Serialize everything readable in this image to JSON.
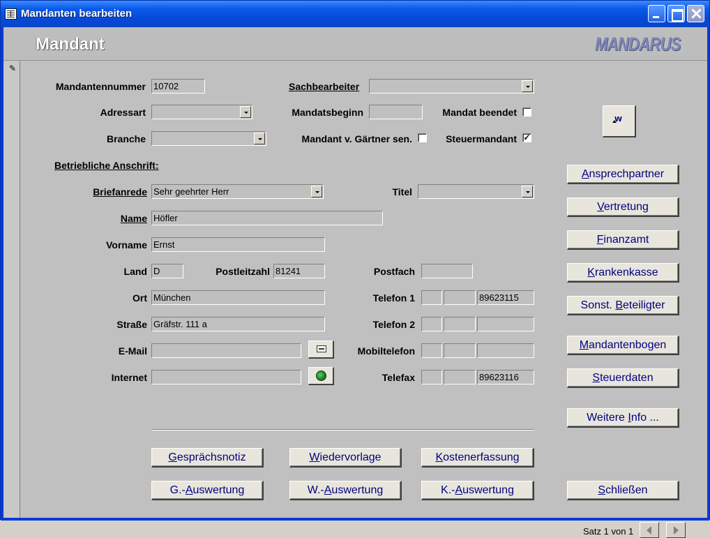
{
  "window": {
    "title": "Mandanten bearbeiten"
  },
  "header": {
    "title": "Mandant",
    "brand": "MANDARUS"
  },
  "record_selector": {
    "icon": "pencil-icon",
    "glyph": "✎"
  },
  "fields": {
    "mandantennummer": {
      "label": "Mandantennummer",
      "value": "10702"
    },
    "sachbearbeiter": {
      "label": "Sachbearbeiter",
      "value": ""
    },
    "adressart": {
      "label": "Adressart",
      "value": ""
    },
    "mandatsbeginn": {
      "label": "Mandatsbeginn",
      "value": ""
    },
    "mandat_beendet": {
      "label": "Mandat beendet",
      "checked": false
    },
    "branche": {
      "label": "Branche",
      "value": ""
    },
    "mandant_gaertner": {
      "label": "Mandant v. Gärtner sen.",
      "checked": false
    },
    "steuermandant": {
      "label": "Steuermandant",
      "checked": true,
      "mark": "✓"
    },
    "section_heading": "Betriebliche Anschrift:",
    "briefanrede": {
      "label": "Briefanrede",
      "value": "Sehr geehrter Herr"
    },
    "titel": {
      "label": "Titel",
      "value": ""
    },
    "name": {
      "label": "Name",
      "value": "Höfler"
    },
    "vorname": {
      "label": "Vorname",
      "value": "Ernst"
    },
    "land": {
      "label": "Land",
      "value": "D"
    },
    "postleitzahl": {
      "label": "Postleitzahl",
      "value": "81241"
    },
    "postfach": {
      "label": "Postfach",
      "value": ""
    },
    "ort": {
      "label": "Ort",
      "value": "München"
    },
    "strasse": {
      "label": "Straße",
      "value": "Gräfstr. 111 a"
    },
    "email": {
      "label": "E-Mail",
      "value": ""
    },
    "internet": {
      "label": "Internet",
      "value": ""
    },
    "telefon1": {
      "label": "Telefon 1",
      "country": "",
      "area": "",
      "number": "89623115"
    },
    "telefon2": {
      "label": "Telefon 2",
      "country": "",
      "area": "",
      "number": ""
    },
    "mobiltelefon": {
      "label": "Mobiltelefon",
      "country": "",
      "area": "",
      "number": ""
    },
    "telefax": {
      "label": "Telefax",
      "country": "",
      "area": "",
      "number": "89623116"
    }
  },
  "side_buttons": [
    {
      "pre": "",
      "ul": "A",
      "post": "nsprechpartner"
    },
    {
      "pre": "",
      "ul": "V",
      "post": "ertretung"
    },
    {
      "pre": "",
      "ul": "F",
      "post": "inanzamt"
    },
    {
      "pre": "",
      "ul": "K",
      "post": "rankenkasse"
    },
    {
      "pre": "Sonst. ",
      "ul": "B",
      "post": "eteiligter"
    },
    {
      "pre": "",
      "ul": "M",
      "post": "andantenbogen"
    },
    {
      "pre": "",
      "ul": "S",
      "post": "teuerdaten"
    },
    {
      "pre": "Weitere ",
      "ul": "I",
      "post": "nfo ..."
    },
    {
      "pre": "",
      "ul": "S",
      "post": "chließen"
    }
  ],
  "bottom_buttons": [
    {
      "pre": "",
      "ul": "G",
      "post": "esprächsnotiz"
    },
    {
      "pre": "",
      "ul": "W",
      "post": "iedervorlage"
    },
    {
      "pre": "",
      "ul": "K",
      "post": "ostenerfassung"
    },
    {
      "pre": "G.-",
      "ul": "A",
      "post": "uswertung"
    },
    {
      "pre": "W.-",
      "ul": "A",
      "post": "uswertung"
    },
    {
      "pre": "K.-",
      "ul": "A",
      "post": "uswertung"
    }
  ],
  "icons": {
    "word": "W",
    "email_button": "mail-icon",
    "internet_button": "globe-icon"
  },
  "navigation": {
    "record_text": "Satz 1 von 1"
  }
}
